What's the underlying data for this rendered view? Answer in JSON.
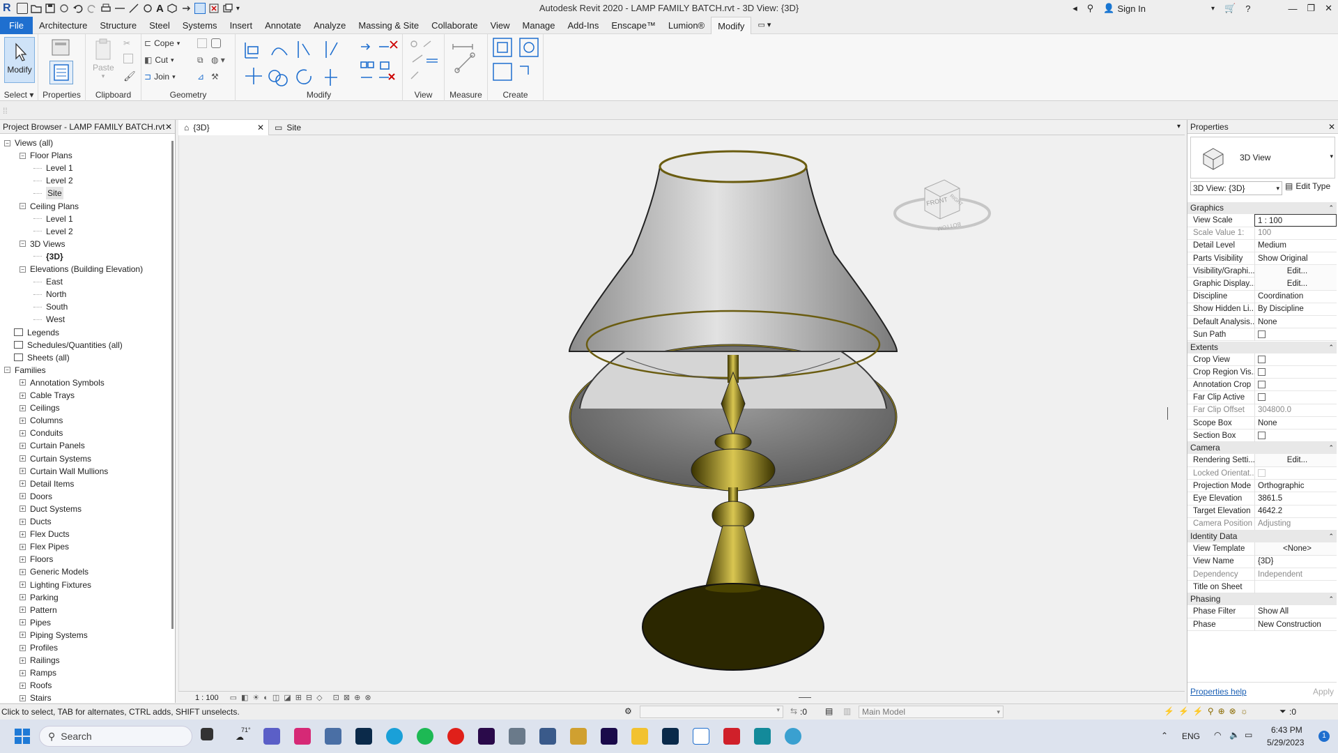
{
  "app": {
    "title": "Autodesk Revit 2020 - LAMP FAMILY BATCH.rvt - 3D View: {3D}",
    "sign_in": "Sign In"
  },
  "menu": [
    "File",
    "Architecture",
    "Structure",
    "Steel",
    "Systems",
    "Insert",
    "Annotate",
    "Analyze",
    "Massing & Site",
    "Collaborate",
    "View",
    "Manage",
    "Add-Ins",
    "Enscape™",
    "Lumion®",
    "Modify"
  ],
  "ribbon": {
    "select_label": "Select",
    "modify_label": "Modify",
    "properties_label": "Properties",
    "paste_label": "Paste",
    "clipboard_label": "Clipboard",
    "cope_label": "Cope",
    "cut_label": "Cut",
    "join_label": "Join",
    "geometry_label": "Geometry",
    "modify_panel_label": "Modify",
    "view_label": "View",
    "measure_label": "Measure",
    "create_label": "Create"
  },
  "browser": {
    "title": "Project Browser - LAMP FAMILY BATCH.rvt",
    "tree": [
      {
        "label": "Views (all)",
        "level": 0,
        "exp": "−"
      },
      {
        "label": "Floor Plans",
        "level": 1,
        "exp": "−"
      },
      {
        "label": "Level 1",
        "level": 2
      },
      {
        "label": "Level 2",
        "level": 2
      },
      {
        "label": "Site",
        "level": 2,
        "selected": true
      },
      {
        "label": "Ceiling Plans",
        "level": 1,
        "exp": "−"
      },
      {
        "label": "Level 1",
        "level": 2
      },
      {
        "label": "Level 2",
        "level": 2
      },
      {
        "label": "3D Views",
        "level": 1,
        "exp": "−"
      },
      {
        "label": "{3D}",
        "level": 2,
        "bold": true
      },
      {
        "label": "Elevations (Building Elevation)",
        "level": 1,
        "exp": "−"
      },
      {
        "label": "East",
        "level": 2
      },
      {
        "label": "North",
        "level": 2
      },
      {
        "label": "South",
        "level": 2
      },
      {
        "label": "West",
        "level": 2
      },
      {
        "label": "Legends",
        "level": 0
      },
      {
        "label": "Schedules/Quantities (all)",
        "level": 0
      },
      {
        "label": "Sheets (all)",
        "level": 0
      },
      {
        "label": "Families",
        "level": 0,
        "exp": "−"
      },
      {
        "label": "Annotation Symbols",
        "level": 1,
        "exp": "+"
      },
      {
        "label": "Cable Trays",
        "level": 1,
        "exp": "+"
      },
      {
        "label": "Ceilings",
        "level": 1,
        "exp": "+"
      },
      {
        "label": "Columns",
        "level": 1,
        "exp": "+"
      },
      {
        "label": "Conduits",
        "level": 1,
        "exp": "+"
      },
      {
        "label": "Curtain Panels",
        "level": 1,
        "exp": "+"
      },
      {
        "label": "Curtain Systems",
        "level": 1,
        "exp": "+"
      },
      {
        "label": "Curtain Wall Mullions",
        "level": 1,
        "exp": "+"
      },
      {
        "label": "Detail Items",
        "level": 1,
        "exp": "+"
      },
      {
        "label": "Doors",
        "level": 1,
        "exp": "+"
      },
      {
        "label": "Duct Systems",
        "level": 1,
        "exp": "+"
      },
      {
        "label": "Ducts",
        "level": 1,
        "exp": "+"
      },
      {
        "label": "Flex Ducts",
        "level": 1,
        "exp": "+"
      },
      {
        "label": "Flex Pipes",
        "level": 1,
        "exp": "+"
      },
      {
        "label": "Floors",
        "level": 1,
        "exp": "+"
      },
      {
        "label": "Generic Models",
        "level": 1,
        "exp": "+"
      },
      {
        "label": "Lighting Fixtures",
        "level": 1,
        "exp": "+"
      },
      {
        "label": "Parking",
        "level": 1,
        "exp": "+"
      },
      {
        "label": "Pattern",
        "level": 1,
        "exp": "+"
      },
      {
        "label": "Pipes",
        "level": 1,
        "exp": "+"
      },
      {
        "label": "Piping Systems",
        "level": 1,
        "exp": "+"
      },
      {
        "label": "Profiles",
        "level": 1,
        "exp": "+"
      },
      {
        "label": "Railings",
        "level": 1,
        "exp": "+"
      },
      {
        "label": "Ramps",
        "level": 1,
        "exp": "+"
      },
      {
        "label": "Roofs",
        "level": 1,
        "exp": "+"
      },
      {
        "label": "Stairs",
        "level": 1,
        "exp": "+"
      }
    ]
  },
  "tabs": [
    {
      "label": "{3D}"
    },
    {
      "label": "Site"
    }
  ],
  "viewcube": {
    "front": "FRONT",
    "right": "RIGHT",
    "bottom": "BOTTOM"
  },
  "view_scale_display": "1 : 100",
  "properties": {
    "title": "Properties",
    "type_name": "3D View",
    "type_selector": "3D View: {3D}",
    "edit_type": "Edit Type",
    "sections": [
      {
        "name": "Graphics",
        "rows": [
          {
            "key": "View Scale",
            "value": "1 : 100",
            "box": true
          },
          {
            "key": "Scale Value    1:",
            "value": "100",
            "grey": true
          },
          {
            "key": "Detail Level",
            "value": "Medium"
          },
          {
            "key": "Parts Visibility",
            "value": "Show Original"
          },
          {
            "key": "Visibility/Graphi...",
            "value": "Edit...",
            "button": true
          },
          {
            "key": "Graphic Display...",
            "value": "Edit...",
            "button": true
          },
          {
            "key": "Discipline",
            "value": "Coordination"
          },
          {
            "key": "Show Hidden Li...",
            "value": "By Discipline"
          },
          {
            "key": "Default Analysis...",
            "value": "None"
          },
          {
            "key": "Sun Path",
            "check": true
          }
        ]
      },
      {
        "name": "Extents",
        "rows": [
          {
            "key": "Crop View",
            "check": true
          },
          {
            "key": "Crop Region Vis...",
            "check": true
          },
          {
            "key": "Annotation Crop",
            "check": true
          },
          {
            "key": "Far Clip Active",
            "check": true
          },
          {
            "key": "Far Clip Offset",
            "value": "304800.0",
            "grey": true
          },
          {
            "key": "Scope Box",
            "value": "None"
          },
          {
            "key": "Section Box",
            "check": true
          }
        ]
      },
      {
        "name": "Camera",
        "rows": [
          {
            "key": "Rendering Setti...",
            "value": "Edit...",
            "button": true
          },
          {
            "key": "Locked Orientat...",
            "check": true,
            "grey": true
          },
          {
            "key": "Projection Mode",
            "value": "Orthographic"
          },
          {
            "key": "Eye Elevation",
            "value": "3861.5"
          },
          {
            "key": "Target Elevation",
            "value": "4642.2"
          },
          {
            "key": "Camera Position",
            "value": "Adjusting",
            "grey": true
          }
        ]
      },
      {
        "name": "Identity Data",
        "rows": [
          {
            "key": "View Template",
            "value": "<None>",
            "button": true
          },
          {
            "key": "View Name",
            "value": "{3D}"
          },
          {
            "key": "Dependency",
            "value": "Independent",
            "grey": true
          },
          {
            "key": "Title on Sheet",
            "value": ""
          }
        ]
      },
      {
        "name": "Phasing",
        "rows": [
          {
            "key": "Phase Filter",
            "value": "Show All"
          },
          {
            "key": "Phase",
            "value": "New Construction"
          }
        ]
      }
    ],
    "help": "Properties help",
    "apply": "Apply"
  },
  "status": {
    "hint": "Click to select, TAB for alternates, CTRL adds, SHIFT unselects.",
    "count": ":0",
    "model": "Main Model",
    "filter_count": ":0"
  },
  "taskbar": {
    "search_placeholder": "Search",
    "weather": "71°",
    "lang": "ENG",
    "time": "6:43 PM",
    "date": "5/29/2023",
    "notif": "1"
  },
  "colors": {
    "accent": "#1f6fcf",
    "brass": "#b8a23a",
    "shade": "#d8d8d8"
  }
}
